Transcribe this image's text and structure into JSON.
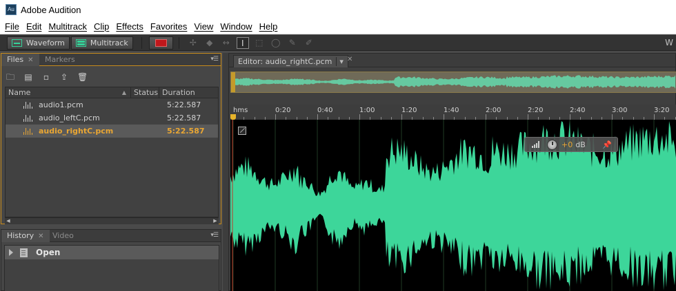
{
  "window": {
    "title": "Adobe Audition",
    "icon_text": "Au"
  },
  "menu": [
    "File",
    "Edit",
    "Multitrack",
    "Clip",
    "Effects",
    "Favorites",
    "View",
    "Window",
    "Help"
  ],
  "toolbar": {
    "waveform_label": "Waveform",
    "multitrack_label": "Multitrack",
    "right_text": "W"
  },
  "files_panel": {
    "tabs": [
      "Files",
      "Markers"
    ],
    "columns": [
      "Name",
      "Status",
      "Duration"
    ],
    "files": [
      {
        "name": "audio1.pcm",
        "status": "",
        "duration": "5:22.587",
        "selected": false
      },
      {
        "name": "audio_leftC.pcm",
        "status": "",
        "duration": "5:22.587",
        "selected": false
      },
      {
        "name": "audio_rightC.pcm",
        "status": "",
        "duration": "5:22.587",
        "selected": true
      }
    ]
  },
  "history_panel": {
    "tabs": [
      "History",
      "Video"
    ],
    "items": [
      "Open"
    ]
  },
  "editor": {
    "tab_label": "Editor: audio_rightC.pcm",
    "timeline_labels": [
      "hms",
      "0:20",
      "0:40",
      "1:00",
      "1:20",
      "1:40",
      "2:00",
      "2:20",
      "2:40",
      "3:00",
      "3:20"
    ],
    "hud": {
      "value": "+0",
      "unit": "dB"
    }
  },
  "colors": {
    "waveform": "#3dd69a",
    "accent": "#e9a633",
    "background": "#000000"
  }
}
